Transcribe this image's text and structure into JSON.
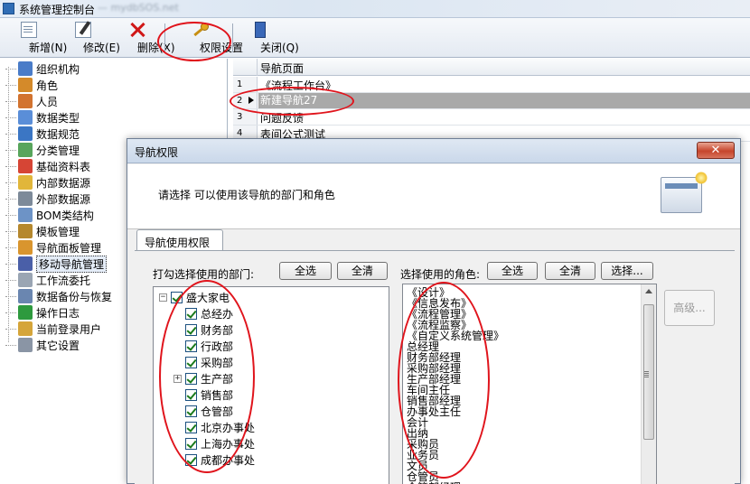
{
  "window": {
    "title": "系统管理控制台",
    "blurred_text": "— mydbSOS.net"
  },
  "toolbar": {
    "new": "新增(N)",
    "edit": "修改(E)",
    "delete": "删除(X)",
    "permission": "权限设置",
    "close": "关闭(Q)"
  },
  "tree": {
    "items": [
      {
        "label": "组织机构",
        "icon": "org-chart-icon",
        "color": "#4a7cc8"
      },
      {
        "label": "角色",
        "icon": "users-group-icon",
        "color": "#d48a2a"
      },
      {
        "label": "人员",
        "icon": "person-icon",
        "color": "#d2732f"
      },
      {
        "label": "数据类型",
        "icon": "data-type-icon",
        "color": "#5a8ed8"
      },
      {
        "label": "数据规范",
        "icon": "data-spec-icon",
        "color": "#3b76c4"
      },
      {
        "label": "分类管理",
        "icon": "category-icon",
        "color": "#58a55c"
      },
      {
        "label": "基础资料表",
        "icon": "table-icon",
        "color": "#d64535"
      },
      {
        "label": "内部数据源",
        "icon": "database-icon",
        "color": "#e1b63a"
      },
      {
        "label": "外部数据源",
        "icon": "external-database-icon",
        "color": "#7d8a99"
      },
      {
        "label": "BOM类结构",
        "icon": "bom-structure-icon",
        "color": "#6d93c6"
      },
      {
        "label": "模板管理",
        "icon": "template-icon",
        "color": "#b5882e"
      },
      {
        "label": "导航面板管理",
        "icon": "nav-panel-icon",
        "color": "#d9952e"
      },
      {
        "label": "移动导航管理",
        "icon": "mobile-nav-icon",
        "color": "#4a5fa8",
        "selected": true
      },
      {
        "label": "工作流委托",
        "icon": "workflow-icon",
        "color": "#9aa5b3"
      },
      {
        "label": "数据备份与恢复",
        "icon": "backup-icon",
        "color": "#6a86b0"
      },
      {
        "label": "操作日志",
        "icon": "log-icon",
        "color": "#2e9a3e"
      },
      {
        "label": "当前登录用户",
        "icon": "current-user-icon",
        "color": "#d5a53a"
      },
      {
        "label": "其它设置",
        "icon": "settings-icon",
        "color": "#8a95a5"
      }
    ]
  },
  "grid": {
    "header": "导航页面",
    "rows": [
      {
        "num": "1",
        "text": "《流程工作台》"
      },
      {
        "num": "2",
        "text": "新建导航27",
        "selected": true
      },
      {
        "num": "3",
        "text": "问题反馈"
      },
      {
        "num": "4",
        "text": "表间公式测试"
      }
    ]
  },
  "dialog": {
    "title": "导航权限",
    "description": "请选择 可以使用该导航的部门和角色",
    "tab": "导航使用权限",
    "dept_label": "打勾选择使用的部门:",
    "select_all": "全选",
    "clear_all": "全清",
    "role_label": "选择使用的角色:",
    "select_more": "选择...",
    "advanced": "高级...",
    "departments": {
      "root": "盛大家电",
      "children": [
        {
          "label": "总经办",
          "expandable": false
        },
        {
          "label": "财务部",
          "expandable": false
        },
        {
          "label": "行政部",
          "expandable": false
        },
        {
          "label": "采购部",
          "expandable": false
        },
        {
          "label": "生产部",
          "expandable": true
        },
        {
          "label": "销售部",
          "expandable": false
        },
        {
          "label": "仓管部",
          "expandable": false
        },
        {
          "label": "北京办事处",
          "expandable": false
        },
        {
          "label": "上海办事处",
          "expandable": false
        },
        {
          "label": "成都办事处",
          "expandable": false
        }
      ]
    },
    "roles": [
      "《设计》",
      "《信息发布》",
      "《流程管理》",
      "《流程监察》",
      "《自定义系统管理》",
      "总经理",
      "财务部经理",
      "采购部经理",
      "生产部经理",
      "车间主任",
      "销售部经理",
      "办事处主任",
      "会计",
      "出纳",
      "采购员",
      "业务员",
      "文员",
      "仓管员",
      "仓管部经理"
    ]
  }
}
